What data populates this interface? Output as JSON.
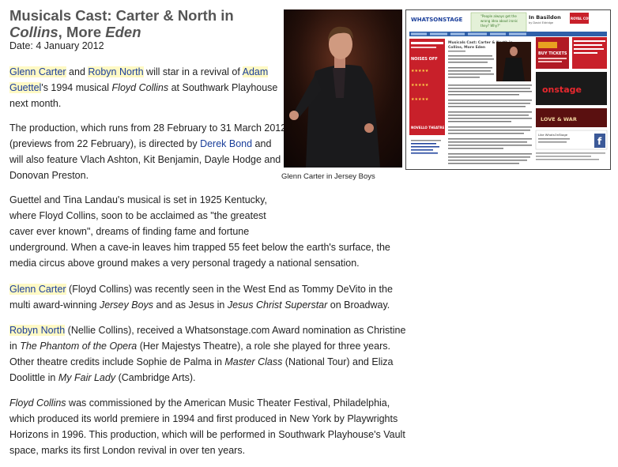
{
  "article": {
    "title_lead": "Musicals Cast: Carter & North in",
    "title_italic1": "Collins",
    "title_mid": ", More ",
    "title_italic2": "Eden",
    "date": "Date: 4 January 2012"
  },
  "paragraphs": {
    "p1": {
      "link_carter": "Glenn Carter",
      "t1": " and ",
      "link_north": "Robyn North",
      "t2": " will star in a revival of ",
      "link_guettel_1": "Adam",
      "link_guettel_2": "Guettel",
      "t3": "'s 1994 musical ",
      "work": "Floyd Collins",
      "t4": " at Southwark Playhouse",
      "t5": "next month."
    },
    "p2": {
      "t1": "The production, which runs from 28 February to 31 March 2012",
      "t2": "(previews from 22 February), is directed by ",
      "link_bond": "Derek Bond",
      "t3": " and",
      "t4": "will also feature Vlach Ashton, Kit Benjamin, Dayle Hodge and",
      "t5": "Donovan Preston."
    },
    "p3": {
      "l1": "Guettel and Tina Landau's musical is set in 1925 Kentucky,",
      "l2": "where Floyd Collins, soon to be acclaimed as \"the greatest",
      "l3": "caver ever known\", dreams of finding fame and fortune",
      "l4": "underground. When a cave-in leaves him trapped 55 feet below the earth's surface, the",
      "l5": "media circus above ground makes a very personal tragedy a national sensation."
    },
    "p4": {
      "link_carter": "Glenn Carter",
      "t1": " (Floyd Collins) was recently seen in the West End as Tommy DeVito in the",
      "t2": "multi award-winning ",
      "work1": "Jersey Boys",
      "t3": " and as Jesus in ",
      "work2": "Jesus Christ Superstar",
      "t4": " on Broadway."
    },
    "p5": {
      "link_north": "Robyn North",
      "t1": " (Nellie Collins), received a Whatsonstage.com Award nomination as Christine",
      "t2": "in ",
      "work1": "The Phantom of the Opera",
      "t3": " (Her Majestys Theatre), a role she played for three years.",
      "t4": "Other theatre credits include Sophie de Palma in ",
      "work2": "Master Class",
      "t5": " (National Tour) and Eliza",
      "t6": "Doolittle in ",
      "work3": "My Fair Lady",
      "t7": " (Cambridge Arts)."
    },
    "p6": {
      "work": "Floyd Collins",
      "t1": " was commissioned by the American Music Theater Festival, Philadelphia,",
      "t2": "which produced its world premiere in 1994 and first produced in New York by Playwrights",
      "t3": "Horizons in 1996. This production, which will be performed in Southwark Playhouse's Vault",
      "t4": "space, marks its first London revival in over ten years."
    }
  },
  "photo": {
    "caption": "Glenn Carter in Jersey Boys"
  },
  "thumbnail": {
    "site_logo": "WHATSONSTAGE",
    "promo_text_1": "\"People always get the",
    "promo_text_2": "wrong idea about ironic",
    "promo_text_3": "they? Why?\"",
    "event_title": "In Basildon",
    "event_sub": "by David Eldridge",
    "venue_logo": "ROYAL COURT",
    "article_title_1": "Musicals Cast: Carter & North in",
    "article_title_2": "Collins, More Eden",
    "banner_1": "NOISES OFF",
    "banner_2": "NOVELLO THEATRE",
    "ad_buy": "BUY TICKETS",
    "ad_onstage": "onstage",
    "ad_love": "LOVE & WAR",
    "fb_prompt": "Like WhatsOnStage"
  },
  "colors": {
    "link": "#1a3e9a",
    "highlight": "#fff9c4",
    "title": "#555555",
    "thumb_red": "#c8202a",
    "thumb_nav": "#2f5fa8"
  }
}
